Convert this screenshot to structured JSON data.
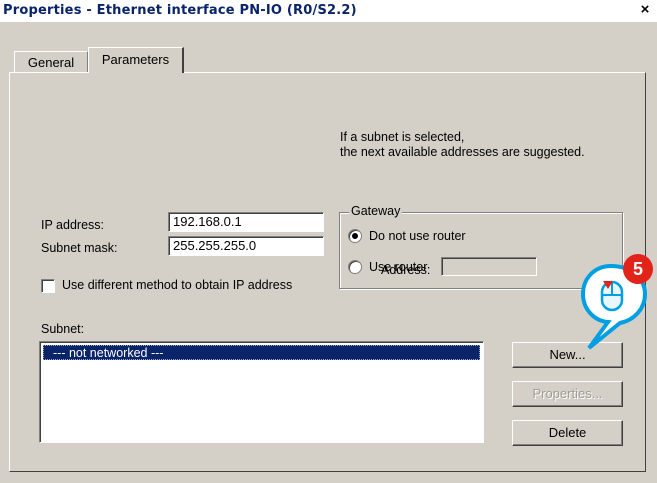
{
  "window": {
    "title": "Properties - Ethernet interface  PN-IO (R0/S2.2)",
    "close_glyph": "×"
  },
  "tabs": [
    {
      "label": "General",
      "active": false
    },
    {
      "label": "Parameters",
      "active": true
    }
  ],
  "hint": {
    "line1": "If a subnet is selected,",
    "line2": "the next available addresses are suggested."
  },
  "ip": {
    "address_label": "IP address:",
    "address_value": "192.168.0.1",
    "mask_label": "Subnet mask:",
    "mask_value": "255.255.255.0"
  },
  "alt_method": {
    "label": "Use different method to obtain IP address",
    "checked": false
  },
  "gateway": {
    "group_label": "Gateway",
    "option_no_router": "Do not use router",
    "option_use_router": "Use router",
    "selected": "Do not use router",
    "address_label": "Address:",
    "address_value": ""
  },
  "subnet": {
    "label": "Subnet:",
    "items": [
      "--- not networked ---"
    ],
    "selected_index": 0
  },
  "buttons": {
    "new": "New...",
    "properties": "Properties...",
    "delete": "Delete"
  },
  "annotation": {
    "step_number": "5",
    "badge_color": "#e2231a",
    "bubble_color": "#009fe3",
    "icon": "mouse-click-icon"
  }
}
